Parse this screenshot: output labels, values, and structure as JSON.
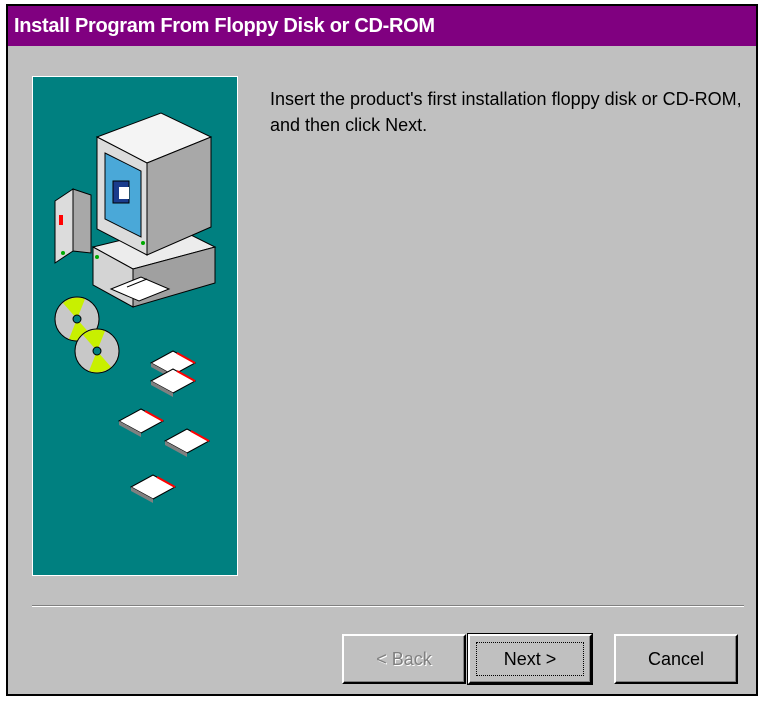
{
  "window": {
    "title": "Install Program From Floppy Disk or CD-ROM",
    "title_bar_color": "#800080"
  },
  "illustration": {
    "background_color": "#008080",
    "icons": [
      "computer-icon",
      "cd-rom-icon",
      "floppy-disk-icon"
    ]
  },
  "message": {
    "line1": "Insert the product's first installation floppy disk or CD-ROM,",
    "line2": "and then click Next."
  },
  "buttons": {
    "back": {
      "label": "< Back",
      "enabled": false
    },
    "next": {
      "label": "Next >",
      "default": true
    },
    "cancel": {
      "label": "Cancel"
    }
  }
}
